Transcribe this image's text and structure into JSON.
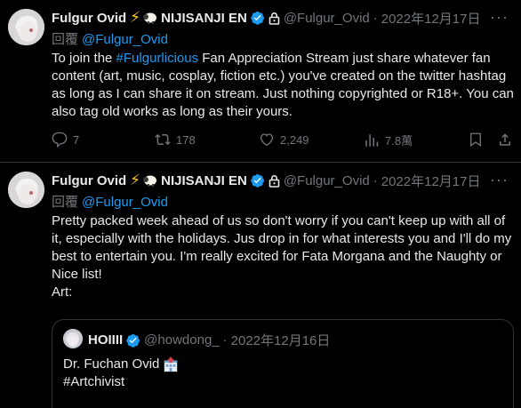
{
  "tweet1": {
    "name": "Fulgur Ovid",
    "org": "NIJISANJI EN",
    "handle": "@Fulgur_Ovid",
    "date": "2022年12月17日",
    "reply_label": "回覆",
    "reply_to": "@Fulgur_Ovid",
    "text_before_tag": "To join the ",
    "hashtag": "#Fulgurlicious",
    "text_after_tag": " Fan Appreciation Stream just share whatever fan content (art, music, cosplay, fiction etc.) you've created on the twitter hashtag as long as I can share it on stream. Just nothing copyrighted or R18+. You can also tag old works as long as their yours.",
    "replies": "7",
    "retweets": "178",
    "likes": "2,249",
    "views": "7.8萬"
  },
  "tweet2": {
    "name": "Fulgur Ovid",
    "org": "NIJISANJI EN",
    "handle": "@Fulgur_Ovid",
    "date": "2022年12月17日",
    "reply_label": "回覆",
    "reply_to": "@Fulgur_Ovid",
    "text": "Pretty packed week ahead of us so don't worry if you can't keep up with all of it, especially with the holidays. Jus drop in for what interests you and I'll do my best to entertain you. I'm really excited for Fata Morgana and the Naughty or Nice list!",
    "text_art": "Art:",
    "quote": {
      "name": "HOIIII",
      "handle": "@howdong_",
      "date": "2022年12月16日",
      "line1": "Dr. Fuchan Ovid",
      "line2": "#Artchivist"
    }
  },
  "separator": "·",
  "more": "···",
  "colors": {
    "background": "#000000",
    "text": "#e7e9ea",
    "muted": "#71767b",
    "accent": "#1d9bf0",
    "border": "#2f3336"
  }
}
